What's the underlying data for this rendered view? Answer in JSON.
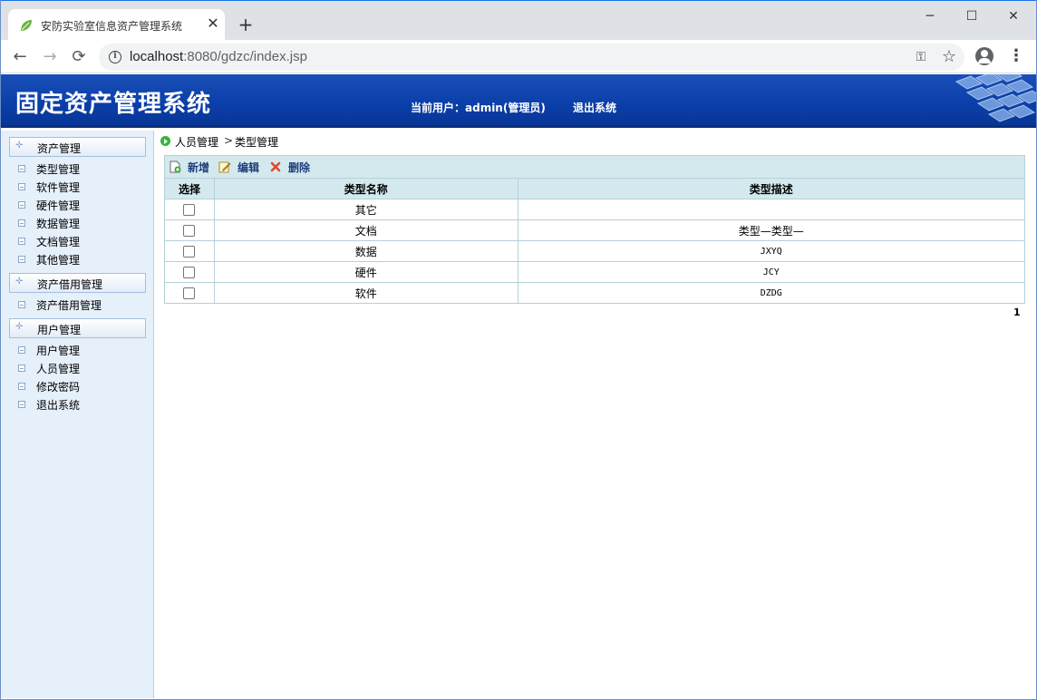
{
  "browser": {
    "tab_title": "安防实验室信息资产管理系统",
    "close_tab": "✕",
    "new_tab": "+",
    "url_host": "localhost",
    "url_rest": ":8080/gdzc/index.jsp",
    "window_controls": {
      "minimize": "─",
      "maximize": "☐",
      "close": "✕"
    },
    "nav": {
      "back": "←",
      "forward": "→",
      "reload": "⟳"
    },
    "icons": {
      "favicon": "leaf-icon",
      "info": "i",
      "key": "⚿",
      "star": "☆",
      "menu": "⋮"
    }
  },
  "header": {
    "title": "固定资产管理系统",
    "user_info": "当前用户：admin(管理员)",
    "logout": "退出系统"
  },
  "sidebar": {
    "groups": [
      {
        "label": "资产管理",
        "items": [
          "类型管理",
          "软件管理",
          "硬件管理",
          "数据管理",
          "文档管理",
          "其他管理"
        ]
      },
      {
        "label": "资产借用管理",
        "items": [
          "资产借用管理"
        ]
      },
      {
        "label": "用户管理",
        "items": [
          "用户管理",
          "人员管理",
          "修改密码",
          "退出系统"
        ]
      }
    ]
  },
  "breadcrumb": {
    "parent": "人员管理",
    "separator": ">",
    "current": "类型管理"
  },
  "toolbar": {
    "add": "新增",
    "edit": "编辑",
    "delete": "删除"
  },
  "table": {
    "columns": [
      "选择",
      "类型名称",
      "类型描述"
    ],
    "rows": [
      {
        "name": "其它",
        "desc": ""
      },
      {
        "name": "文档",
        "desc": "类型—类型—"
      },
      {
        "name": "数据",
        "desc": "JXYQ"
      },
      {
        "name": "硬件",
        "desc": "JCY"
      },
      {
        "name": "软件",
        "desc": "DZDG"
      }
    ]
  },
  "pager": {
    "page": "1"
  },
  "colors": {
    "header_blue": "#0a3ea8",
    "sidebar_bg": "#e6f0fa",
    "table_header": "#d4e9ee",
    "link_blue": "#1d3e7a"
  }
}
